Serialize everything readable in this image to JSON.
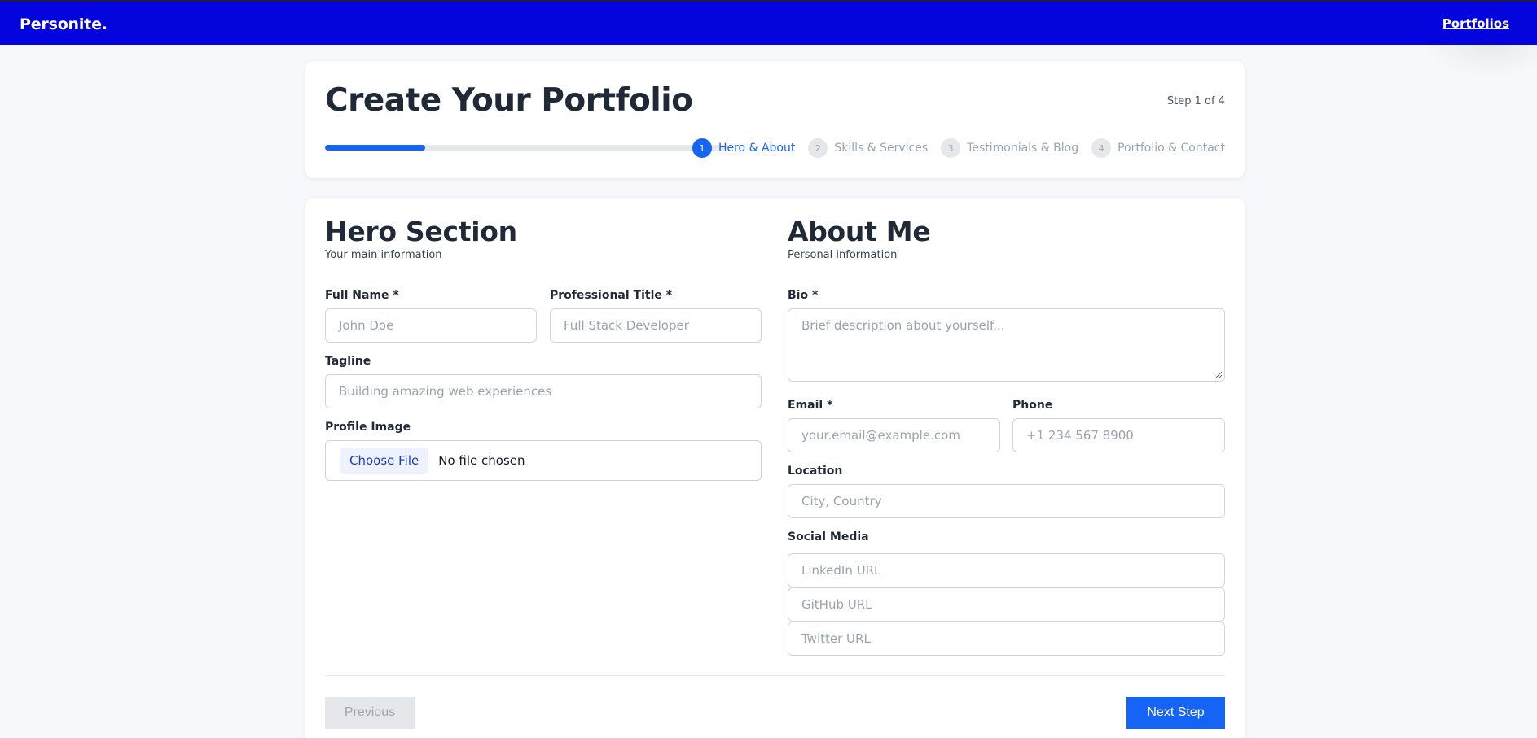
{
  "navbar": {
    "brand": "Personite.",
    "link": "Portfolios"
  },
  "header": {
    "title": "Create Your Portfolio",
    "step_indicator": "Step 1 of 4",
    "progress_percent": 25,
    "steps": [
      {
        "num": "1",
        "label": "Hero & About",
        "active": true
      },
      {
        "num": "2",
        "label": "Skills & Services",
        "active": false
      },
      {
        "num": "3",
        "label": "Testimonials & Blog",
        "active": false
      },
      {
        "num": "4",
        "label": "Portfolio & Contact",
        "active": false
      }
    ]
  },
  "hero": {
    "title": "Hero Section",
    "subtitle": "Your main information",
    "full_name": {
      "label": "Full Name *",
      "placeholder": "John Doe",
      "value": ""
    },
    "professional_title": {
      "label": "Professional Title *",
      "placeholder": "Full Stack Developer",
      "value": ""
    },
    "tagline": {
      "label": "Tagline",
      "placeholder": "Building amazing web experiences",
      "value": ""
    },
    "profile_image": {
      "label": "Profile Image",
      "button": "Choose File",
      "status": "No file chosen"
    }
  },
  "about": {
    "title": "About Me",
    "subtitle": "Personal information",
    "bio": {
      "label": "Bio *",
      "placeholder": "Brief description about yourself...",
      "value": ""
    },
    "email": {
      "label": "Email *",
      "placeholder": "your.email@example.com",
      "value": ""
    },
    "phone": {
      "label": "Phone",
      "placeholder": "+1 234 567 8900",
      "value": ""
    },
    "location": {
      "label": "Location",
      "placeholder": "City, Country",
      "value": ""
    },
    "social": {
      "label": "Social Media",
      "linkedin_placeholder": "LinkedIn URL",
      "github_placeholder": "GitHub URL",
      "twitter_placeholder": "Twitter URL"
    }
  },
  "footer": {
    "previous": "Previous",
    "next": "Next Step"
  },
  "colors": {
    "nav": "#0404dd",
    "accent": "#1664f5"
  }
}
